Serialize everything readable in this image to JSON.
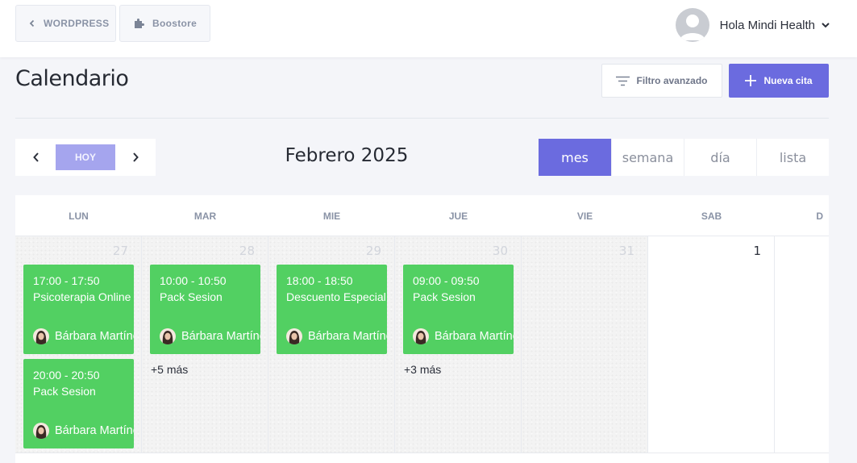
{
  "topbar": {
    "crumb_wordpress": "WORDPRESS",
    "crumb_boostore": "Boostore",
    "user_greeting": "Hola Mindi Health"
  },
  "header": {
    "title": "Calendario",
    "filter_label": "Filtro avanzado",
    "new_label": "Nueva cita"
  },
  "nav": {
    "today_label": "HOY",
    "month_title": "Febrero 2025",
    "views": [
      "mes",
      "semana",
      "día",
      "lista"
    ],
    "active_view": "mes"
  },
  "calendar": {
    "weekdays": [
      "LUN",
      "MAR",
      "MIE",
      "JUE",
      "VIE",
      "SAB",
      "D"
    ],
    "days": [
      "27",
      "28",
      "29",
      "30",
      "31",
      "1",
      ""
    ],
    "events": {
      "lun_1": {
        "time": "17:00 - 17:50",
        "title": "Psicoterapia Online",
        "person": "Bárbara Martínez"
      },
      "lun_2": {
        "time": "20:00 - 20:50",
        "title": "Pack Sesion",
        "person": "Bárbara Martínez"
      },
      "mar_1": {
        "time": "10:00 - 10:50",
        "title": "Pack Sesion",
        "person": "Bárbara Martínez"
      },
      "mie_1": {
        "time": "18:00 - 18:50",
        "title": "Descuento Especial",
        "person": "Bárbara Martínez"
      },
      "jue_1": {
        "time": "09:00 - 09:50",
        "title": "Pack Sesion",
        "person": "Bárbara Martínez"
      }
    },
    "more": {
      "mar": "+5 más",
      "jue": "+3 más"
    }
  },
  "colors": {
    "accent": "#6b6bdf",
    "today_button": "#a5a5ee",
    "event": "#52d062",
    "background": "#f4f5f9"
  }
}
